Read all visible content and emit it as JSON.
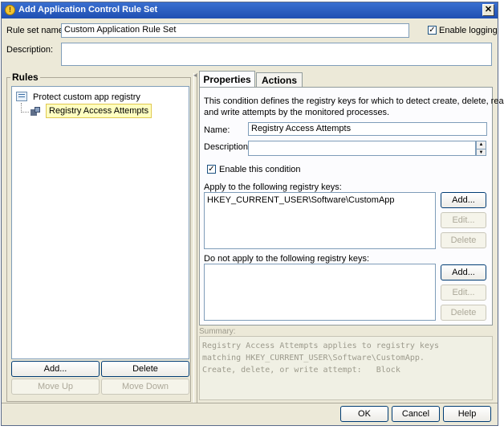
{
  "window": {
    "title": "Add Application Control Rule Set",
    "close_glyph": "✕"
  },
  "ruleset": {
    "name_label": "Rule set name:",
    "name_value": "Custom Application Rule Set",
    "logging_label": "Enable logging",
    "logging_checked": true,
    "description_label": "Description:",
    "description_value": ""
  },
  "rules": {
    "group_label": "Rules",
    "items": [
      {
        "label": "Protect custom app registry",
        "icon": "rule-set-icon"
      },
      {
        "label": "Registry Access Attempts",
        "icon": "registry-condition-icon",
        "selected": true
      }
    ],
    "add_label": "Add...",
    "delete_label": "Delete",
    "move_up_label": "Move Up",
    "move_down_label": "Move Down"
  },
  "tabs": [
    {
      "label": "Properties",
      "active": true
    },
    {
      "label": "Actions",
      "active": false
    }
  ],
  "properties": {
    "intro_line1": "This condition defines the registry keys for which to detect create, delete, read,",
    "intro_line2": "and write attempts by the monitored processes.",
    "name_label": "Name:",
    "name_value": "Registry Access Attempts",
    "description_label": "Description:",
    "description_value": "",
    "enable_label": "Enable this condition",
    "enable_checked": true,
    "apply_label": "Apply to the following registry keys:",
    "apply_keys": [
      "HKEY_CURRENT_USER\\Software\\CustomApp"
    ],
    "not_apply_label": "Do not apply to the following registry keys:",
    "not_apply_keys": [],
    "add_label": "Add...",
    "edit_label": "Edit...",
    "delete_label": "Delete"
  },
  "summary": {
    "label": "Summary:",
    "line1": "Registry Access Attempts applies to registry keys",
    "line2": "matching HKEY_CURRENT_USER\\Software\\CustomApp.",
    "line3": "Create, delete, or write attempt:   Block"
  },
  "footer": {
    "ok_label": "OK",
    "cancel_label": "Cancel",
    "help_label": "Help"
  },
  "colors": {
    "selection_bg": "#ffffc0",
    "title_bar": "#1f4fb2",
    "window_bg": "#ece9d8"
  }
}
